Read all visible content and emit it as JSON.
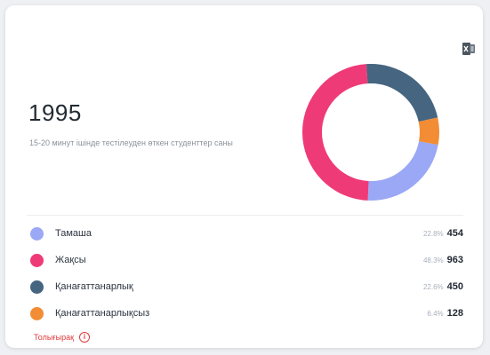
{
  "summary": {
    "total": "1995",
    "subtitle": "15-20 минут ішінде тестілеуден өткен студенттер саны"
  },
  "chart_data": {
    "type": "pie",
    "style": "donut",
    "categories": [
      "Тамаша",
      "Жақсы",
      "Қанағаттанарлық",
      "Қанағаттанарлықсыз"
    ],
    "values": [
      454,
      963,
      450,
      128
    ],
    "percents": [
      "22.8%",
      "48.3%",
      "22.6%",
      "6.4%"
    ],
    "colors": [
      "#9aa8f5",
      "#ef3a78",
      "#456580",
      "#f28c35"
    ],
    "legend": "below"
  },
  "legend": {
    "items": [
      {
        "label": "Тамаша",
        "percent": "22.8%",
        "count": "454",
        "color": "#9aa8f5"
      },
      {
        "label": "Жақсы",
        "percent": "48.3%",
        "count": "963",
        "color": "#ef3a78"
      },
      {
        "label": "Қанағаттанарлық",
        "percent": "22.6%",
        "count": "450",
        "color": "#456580"
      },
      {
        "label": "Қанағаттанарлықсыз",
        "percent": "6.4%",
        "count": "128",
        "color": "#f28c35"
      }
    ]
  },
  "footer": {
    "more_label": "Толығырақ",
    "info_glyph": "i"
  },
  "toolbar": {
    "export_icon": "excel-export-icon"
  }
}
